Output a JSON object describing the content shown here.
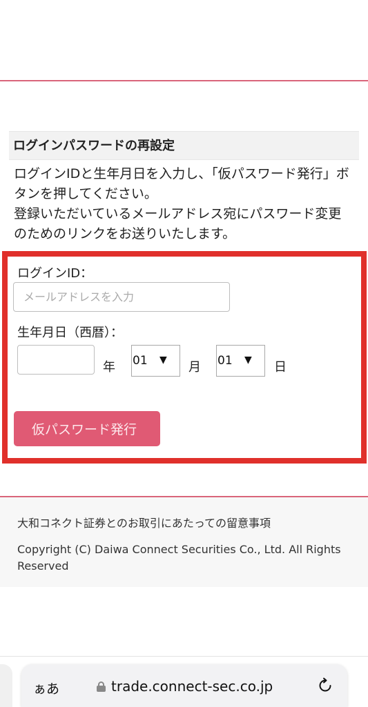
{
  "form_section": {
    "heading": "ログインパスワードの再設定",
    "description_line1": "ログインIDと生年月日を入力し、「仮パスワード発行」ボタンを押してください。",
    "description_line2": "登録いただいているメールアドレス宛にパスワード変更のためのリンクをお送りいたします。",
    "login_id_label": "ログインID：",
    "email_placeholder": "メールアドレスを入力",
    "dob_label": "生年月日（西暦）：",
    "year_value": "",
    "year_unit": "年",
    "month_value": "01",
    "month_unit": "月",
    "day_value": "01",
    "day_unit": "日",
    "issue_button_label": "仮パスワード発行"
  },
  "footer": {
    "notice_link": "大和コネクト証券とのお取引にあたっての留意事項",
    "copyright": "Copyright (C) Daiwa Connect Securities Co., Ltd. All Rights Reserved"
  },
  "browser": {
    "text_size_button": "ぁあ",
    "url": "trade.connect-sec.co.jp"
  },
  "colors": {
    "accent_pink": "#d9647a",
    "highlight_red": "#e0302b",
    "button_pink": "#e05a74"
  },
  "icons": {
    "dropdown_arrow": "▼",
    "lock": "lock-icon",
    "reload": "reload-icon"
  }
}
